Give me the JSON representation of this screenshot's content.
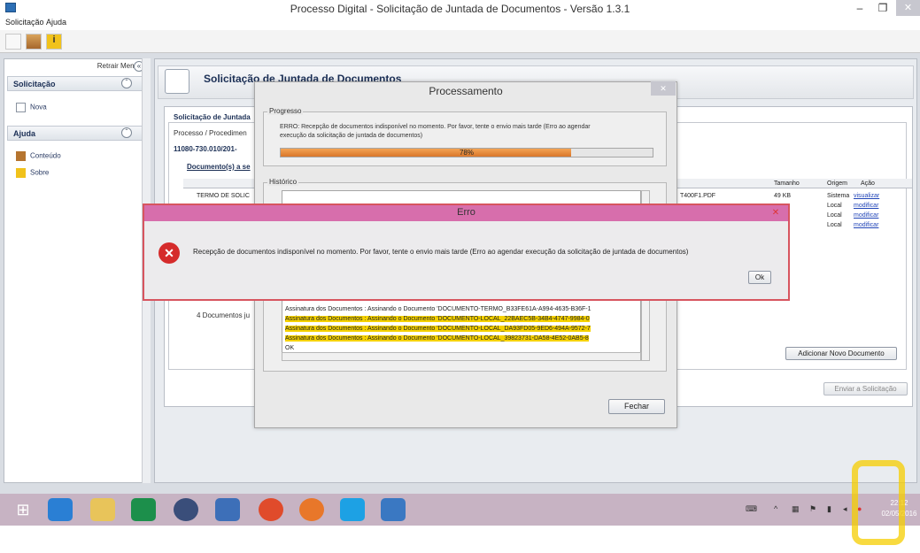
{
  "window": {
    "title": "Processo Digital - Solicitação de Juntada de Documentos - Versão 1.3.1",
    "minimize_glyph": "–",
    "maximize_glyph": "❐",
    "close_glyph": "✕"
  },
  "menu": {
    "items": [
      "Solicitação",
      "Ajuda"
    ]
  },
  "sidebar": {
    "retrair_label": "Retrair Menu",
    "sections": [
      {
        "title": "Solicitação",
        "items": [
          "Nova"
        ]
      },
      {
        "title": "Ajuda",
        "items": [
          "Conteúdo",
          "Sobre"
        ]
      }
    ]
  },
  "main": {
    "header_title": "Solicitação de Juntada de Documentos",
    "panel_tab": "Solicitação de Juntada",
    "process_label": "Processo / Procedimen",
    "process_number": "11080-730.010/201-",
    "documents_label": "Documento(s) a se",
    "grid": {
      "headers": [
        "Tamanho",
        "Origem",
        "Ação"
      ],
      "first_doc_name": "TERMO DE SOLIC",
      "file_fragment": "T400F1.PDF",
      "rows": [
        {
          "tamanho": "49 KB",
          "origem": "Sistema",
          "acao": "visualizar"
        },
        {
          "tamanho": "",
          "origem": "Local",
          "acao": "modificar"
        },
        {
          "tamanho": "",
          "origem": "Local",
          "acao": "modificar"
        },
        {
          "tamanho": "",
          "origem": "Local",
          "acao": "modificar"
        }
      ]
    },
    "documents_count": "4 Documentos ju",
    "add_button": "Adicionar Novo Documento",
    "send_button": "Enviar a Solicitação"
  },
  "processing": {
    "title": "Processamento",
    "progress_label": "Progresso",
    "progress_message_1": "ERRO: Recepção de documentos indisponível no momento. Por favor, tente o envio mais tarde (Erro ao agendar",
    "progress_message_2": "execução da solicitação de juntada de documentos)",
    "progress_percent": 78,
    "progress_text": "78%",
    "history_label": "Histórico",
    "log": [
      "Assinatura dos Documentos : Assinando o Documento 'DOCUMENTO-TERMO_B33FE61A-A994-4635-B36F-1",
      "Assinatura dos Documentos : Assinando o Documento 'DOCUMENTO-LOCAL_22BAEC5B-34B4-4747-9984-0",
      "Assinatura dos Documentos : Assinando o Documento 'DOCUMENTO-LOCAL_DA93FD05-9ED6-494A-9572-7",
      "Assinatura dos Documentos : Assinando o Documento 'DOCUMENTO-LOCAL_39823731-DA58-4E52-0AB5-8",
      "OK"
    ],
    "close_button": "Fechar"
  },
  "error_dialog": {
    "title": "Erro",
    "message": "Recepção de documentos indisponível no momento. Por favor, tente o envio mais tarde (Erro ao agendar execução da solicitação de juntada de documentos)",
    "ok_button": "Ok",
    "close_glyph": "✕"
  },
  "taskbar": {
    "clock_time": "22:12",
    "clock_date": "02/05/2016"
  },
  "colors": {
    "highlight_yellow": "#f5cd00",
    "error_title": "#d76eac",
    "progress": "#e0843a",
    "taskbar": "#c7b3c3"
  }
}
